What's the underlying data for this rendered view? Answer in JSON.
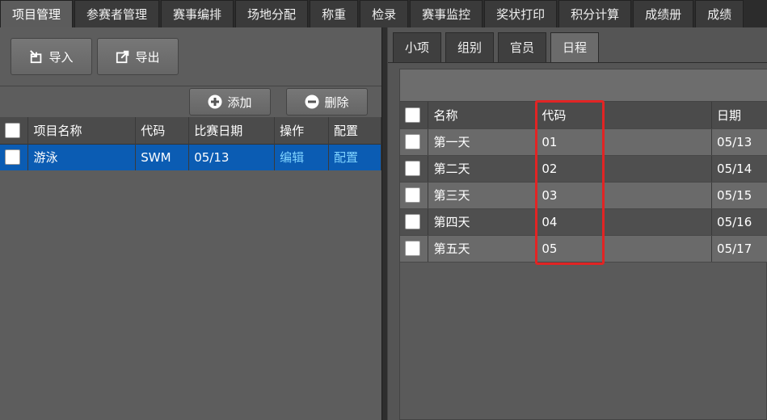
{
  "top_tabs": [
    "项目管理",
    "参赛者管理",
    "赛事编排",
    "场地分配",
    "称重",
    "检录",
    "赛事监控",
    "奖状打印",
    "积分计算",
    "成绩册",
    "成绩"
  ],
  "left": {
    "import_label": "导入",
    "export_label": "导出",
    "add_label": "添加",
    "delete_label": "删除",
    "columns": [
      "项目名称",
      "代码",
      "比赛日期",
      "操作",
      "配置"
    ],
    "rows": [
      {
        "name": "游泳",
        "code": "SWM",
        "date": "05/13",
        "action": "编辑",
        "config": "配置"
      }
    ]
  },
  "right": {
    "sub_tabs": [
      "小项",
      "组别",
      "官员",
      "日程"
    ],
    "columns": [
      "名称",
      "代码",
      "日期"
    ],
    "rows": [
      {
        "name": "第一天",
        "code": "01",
        "date": "05/13"
      },
      {
        "name": "第二天",
        "code": "02",
        "date": "05/14"
      },
      {
        "name": "第三天",
        "code": "03",
        "date": "05/15"
      },
      {
        "name": "第四天",
        "code": "04",
        "date": "05/16"
      },
      {
        "name": "第五天",
        "code": "05",
        "date": "05/17"
      }
    ]
  },
  "colors": {
    "selected_row": "#0b5cb3",
    "link": "#7fd3ff",
    "highlight": "#e22424"
  },
  "icons": {
    "import": "import-icon",
    "export": "export-icon",
    "add": "plus-circle-icon",
    "delete": "minus-circle-icon"
  }
}
